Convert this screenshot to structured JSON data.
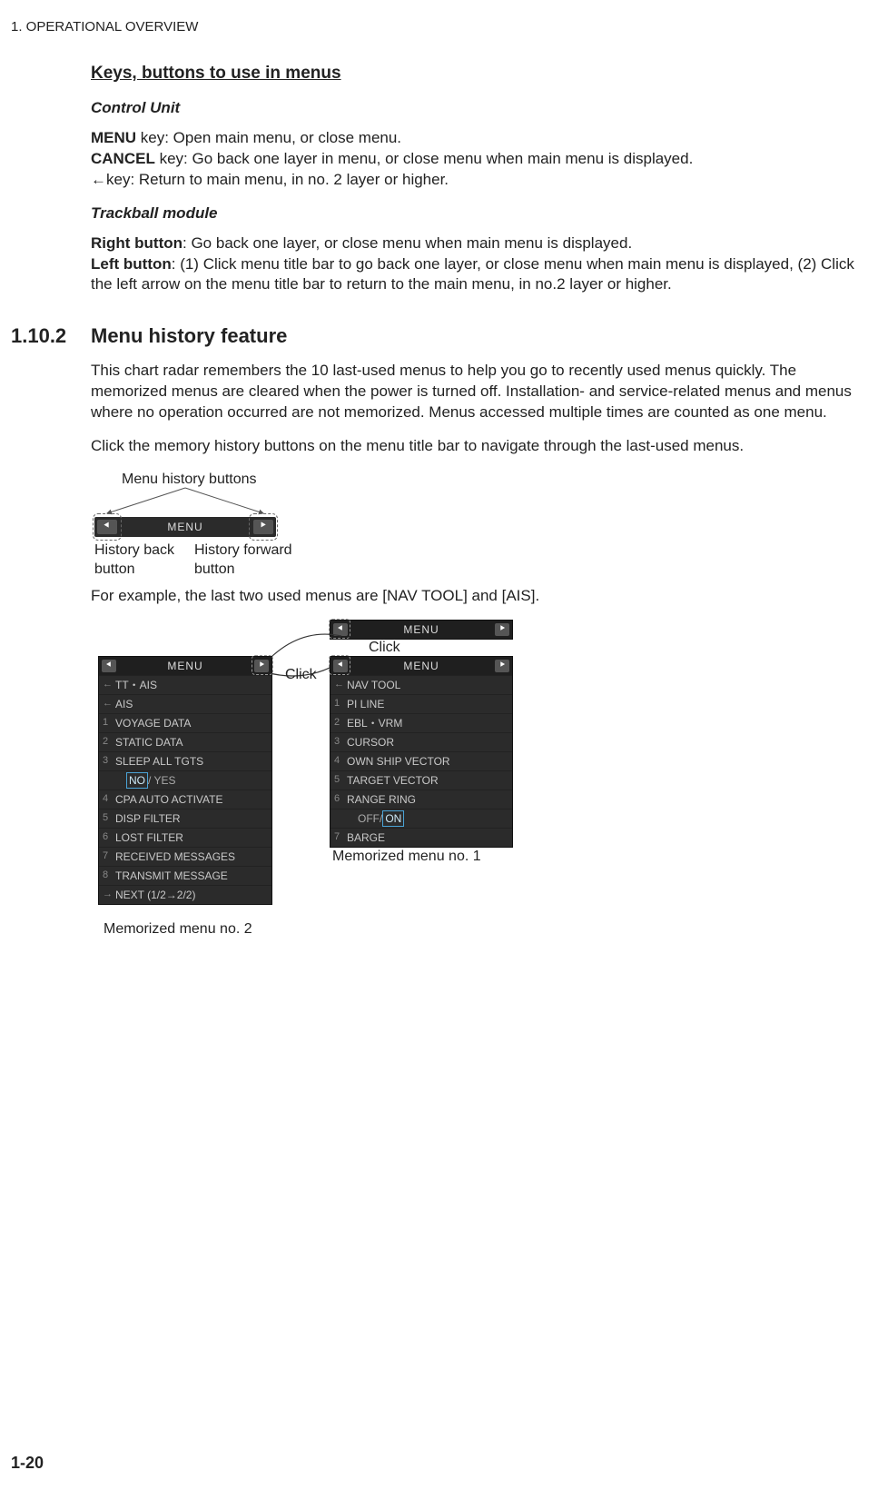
{
  "chapter": "1.  OPERATIONAL OVERVIEW",
  "pageNumber": "1-20",
  "s1": {
    "title": "Keys, buttons to use in menus",
    "controlUnit": {
      "heading": "Control Unit",
      "menuKeyLabel": "MENU",
      "menuKeyText": " key: Open main menu, or close menu.",
      "cancelKeyLabel": "CANCEL",
      "cancelKeyText": " key: Go back one layer in menu, or close menu when main menu is dis­played.",
      "leftArrowText": "←key: Return to main menu, in no. 2 layer or higher."
    },
    "trackball": {
      "heading": "Trackball module",
      "rightLabel": "Right button",
      "rightText": ": Go back one layer, or close menu when main menu is displayed.",
      "leftLabel": "Left button",
      "leftText": ": (1) Click menu title bar to go back one layer, or close menu when main menu is displayed, (2) Click the left arrow on the menu title bar to return to the main menu, in no.2 layer or higher."
    }
  },
  "s2": {
    "num": "1.10.2",
    "title": "Menu history feature",
    "para1": "This chart radar remembers the 10 last-used menus to help you go to recently used menus quickly. The memorized menus are cleared when the power is turned off. In­stallation- and service-related menus and menus where no operation occurred are not memorized. Menus accessed multiple times are counted as one menu.",
    "para2": "Click the memory history buttons on the menu title bar to navigate through the last-used menus.",
    "fig1": {
      "top": "Menu history buttons",
      "menu": "MENU",
      "bl": "History back button",
      "br": "History forward button"
    },
    "para3": "For example, the last two used menus are [NAV TOOL] and [AIS].",
    "fig2": {
      "click": "Click",
      "caption1": "Memorized menu no. 1",
      "caption2": "Memorized menu no. 2",
      "topbar": {
        "title": "MENU"
      },
      "panelA": {
        "title": "MENU",
        "breadcrumb": "TT・AIS",
        "sub": "AIS",
        "rows": [
          {
            "n": "1",
            "t": "VOYAGE DATA"
          },
          {
            "n": "2",
            "t": "STATIC DATA"
          },
          {
            "n": "3",
            "t": "SLEEP ALL TGTS"
          }
        ],
        "opt3": {
          "a": "NO",
          "b": "/ YES"
        },
        "rows2": [
          {
            "n": "4",
            "t": "CPA AUTO ACTIVATE"
          },
          {
            "n": "5",
            "t": "DISP FILTER"
          },
          {
            "n": "6",
            "t": "LOST FILTER"
          },
          {
            "n": "7",
            "t": "RECEIVED MESSAGES"
          },
          {
            "n": "8",
            "t": "TRANSMIT MESSAGE"
          }
        ],
        "next": {
          "arrow": "→",
          "t": "NEXT (1/2→2/2)"
        }
      },
      "panelB": {
        "title": "MENU",
        "breadcrumb": "NAV TOOL",
        "rows": [
          {
            "n": "1",
            "t": "PI LINE"
          },
          {
            "n": "2",
            "t": "EBL・VRM"
          },
          {
            "n": "3",
            "t": "CURSOR"
          },
          {
            "n": "4",
            "t": "OWN SHIP VECTOR"
          },
          {
            "n": "5",
            "t": "TARGET VECTOR"
          },
          {
            "n": "6",
            "t": "RANGE RING"
          }
        ],
        "opt6": {
          "a": "OFF/",
          "b": "ON"
        },
        "rows2": [
          {
            "n": "7",
            "t": "BARGE"
          }
        ]
      }
    }
  }
}
